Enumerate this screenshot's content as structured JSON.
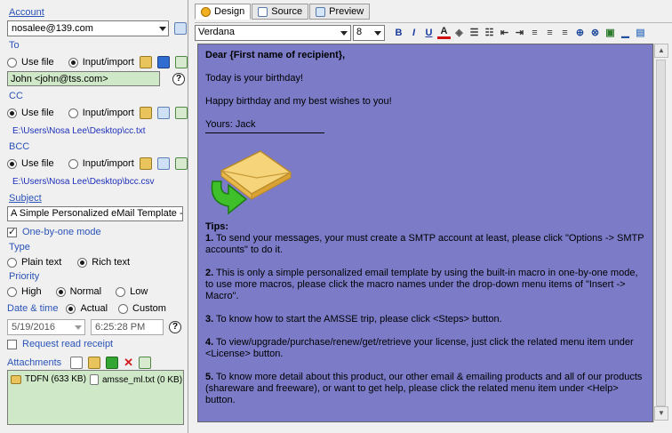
{
  "left": {
    "account": {
      "label": "Account",
      "value": "nosalee@139.com"
    },
    "to": {
      "label": "To",
      "use_file": "Use file",
      "input_import": "Input/import",
      "value": "John <john@tss.com>"
    },
    "cc": {
      "label": "CC",
      "use_file": "Use file",
      "input_import": "Input/import",
      "path": "E:\\Users\\Nosa Lee\\Desktop\\cc.txt"
    },
    "bcc": {
      "label": "BCC",
      "use_file": "Use file",
      "input_import": "Input/import",
      "path": "E:\\Users\\Nosa Lee\\Desktop\\bcc.csv"
    },
    "subject": {
      "label": "Subject",
      "value": "A Simple Personalized eMail Template - Happy"
    },
    "one_by_one": "One-by-one mode",
    "type": {
      "label": "Type",
      "plain": "Plain text",
      "rich": "Rich text"
    },
    "priority": {
      "label": "Priority",
      "high": "High",
      "normal": "Normal",
      "low": "Low"
    },
    "datetime": {
      "label": "Date & time",
      "actual": "Actual",
      "custom": "Custom",
      "date": "5/19/2016",
      "time": "6:25:28 PM"
    },
    "request_receipt": "Request read receipt",
    "attachments": {
      "label": "Attachments",
      "items": [
        {
          "name": "TDFN (633 KB)"
        },
        {
          "name": "amsse_ml.txt (0 KB)"
        }
      ]
    },
    "help_glyph": "?"
  },
  "right": {
    "tabs": [
      {
        "label": "Design",
        "active": true
      },
      {
        "label": "Source",
        "active": false
      },
      {
        "label": "Preview",
        "active": false
      }
    ],
    "toolbar": {
      "font": "Verdana",
      "size": "8",
      "bold": "B",
      "italic": "I",
      "underline": "U",
      "font_color": "A"
    },
    "editor": {
      "greeting": "Dear {First name of recipient},",
      "line1": "Today is your birthday!",
      "line2": "Happy birthday and my best wishes to you!",
      "signoff": "Yours: Jack",
      "tips_title": "Tips:",
      "tips": [
        {
          "num": "1.",
          "text": "To send your messages, your must create a SMTP account at least, please click \"Options -> SMTP accounts\" to do it."
        },
        {
          "num": "2.",
          "text": "This is only a simple personalized email template by using the built-in macro in one-by-one mode, to use more macros, please click the macro names under the drop-down menu items of \"Insert -> Macro\"."
        },
        {
          "num": "3.",
          "text": "To know how to start the AMSSE trip, please click <Steps> button."
        },
        {
          "num": "4.",
          "text": "To view/upgrade/purchase/renew/get/retrieve your license, just click the related menu item under <License> button."
        },
        {
          "num": "5.",
          "text": "To know more detail about this product, our other email & emailing products and all of our products (shareware and freeware), or want to get help, please click the related menu item under <Help> button."
        }
      ]
    }
  },
  "colors": {
    "editor_bg": "#7b7bc8",
    "field_green": "#cfe8c8",
    "label_blue": "#2a53b8"
  }
}
